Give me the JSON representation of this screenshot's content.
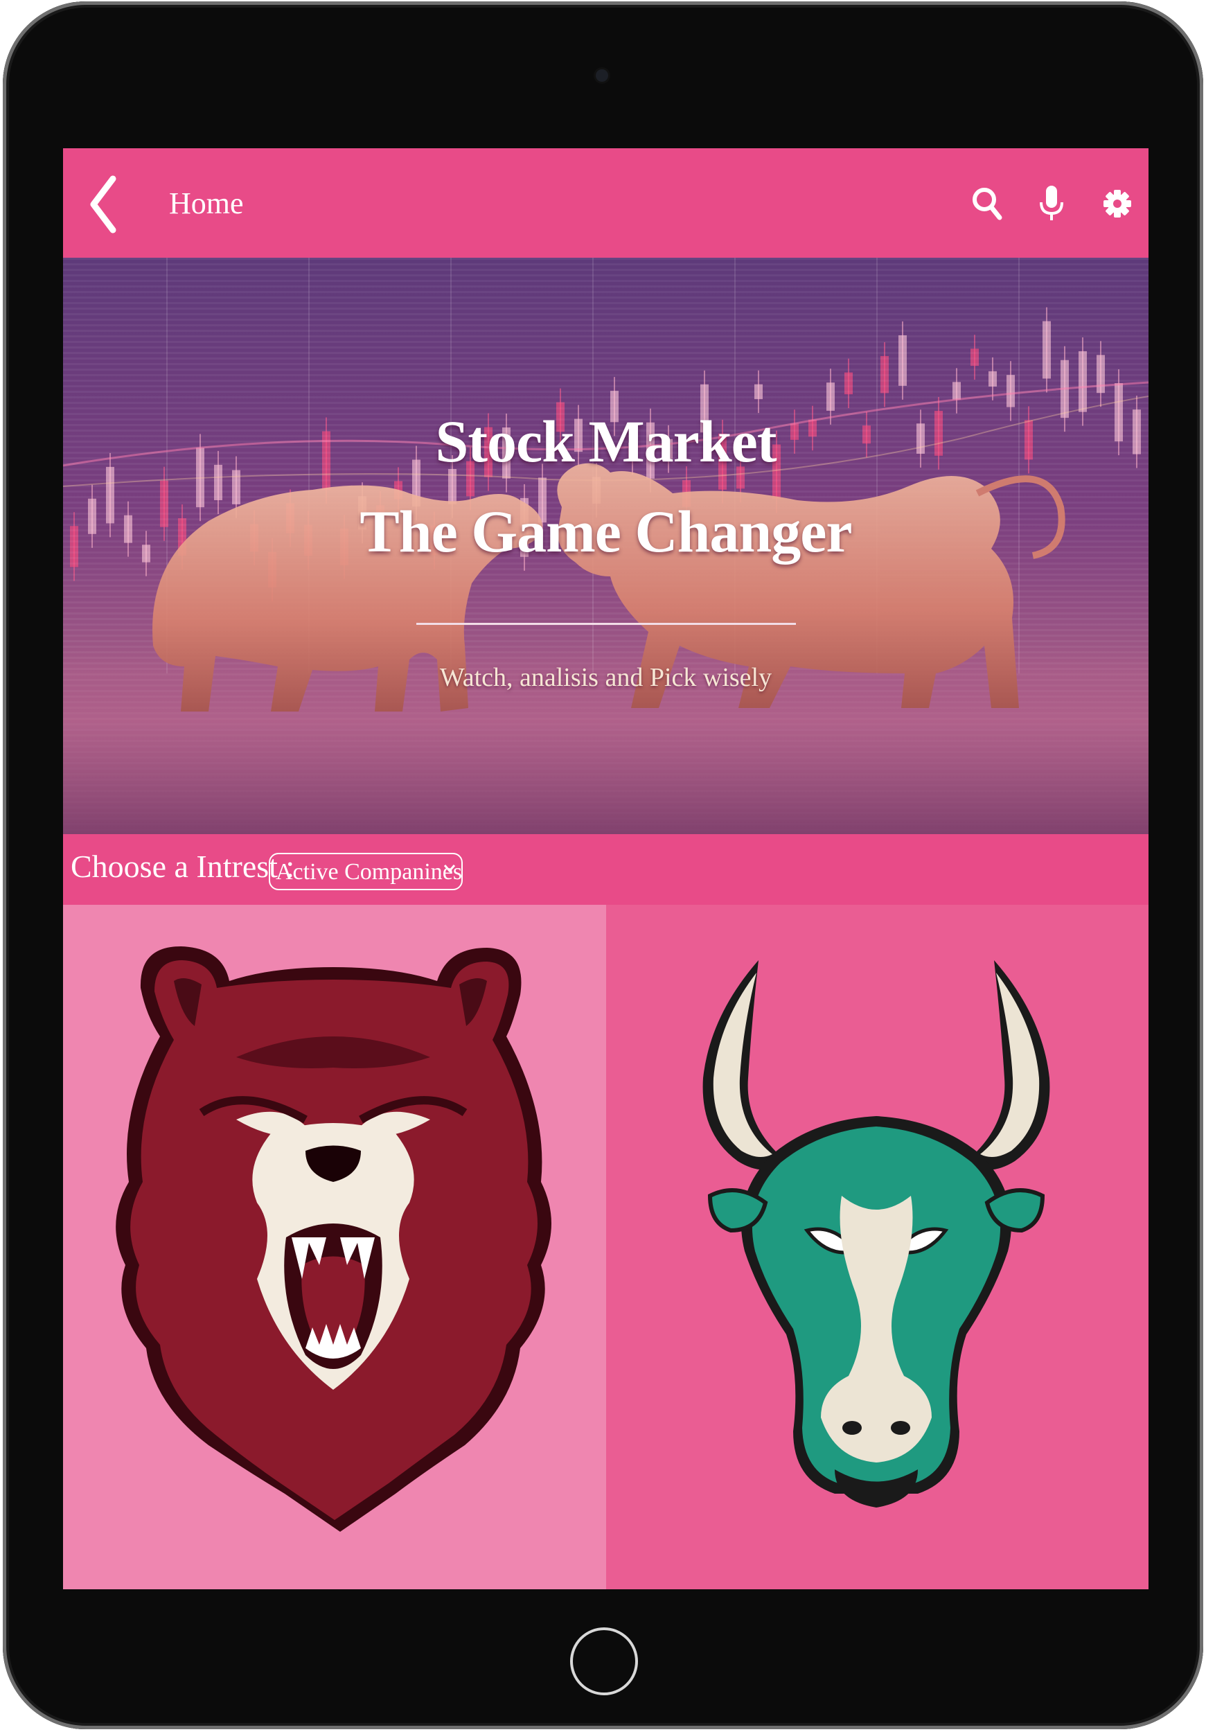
{
  "topbar": {
    "title": "Home",
    "icons": [
      "back-chevron-icon",
      "search-icon",
      "microphone-icon",
      "settings-gear-icon"
    ]
  },
  "hero": {
    "title_line1": "Stock Market",
    "title_line2": "The Game Changer",
    "subtitle": "Watch, analisis and Pick wisely"
  },
  "interest": {
    "label": "Choose a Intrest :",
    "selected": "Active Companines"
  },
  "panels": {
    "left": {
      "icon": "bear-mascot-icon"
    },
    "right": {
      "icon": "bull-mascot-icon"
    }
  },
  "colors": {
    "accent": "#e84b88",
    "left_panel": "#ef86b0",
    "right_panel": "#ea5d93",
    "bear": "#8b1a2c",
    "bull": "#1f9a80"
  }
}
